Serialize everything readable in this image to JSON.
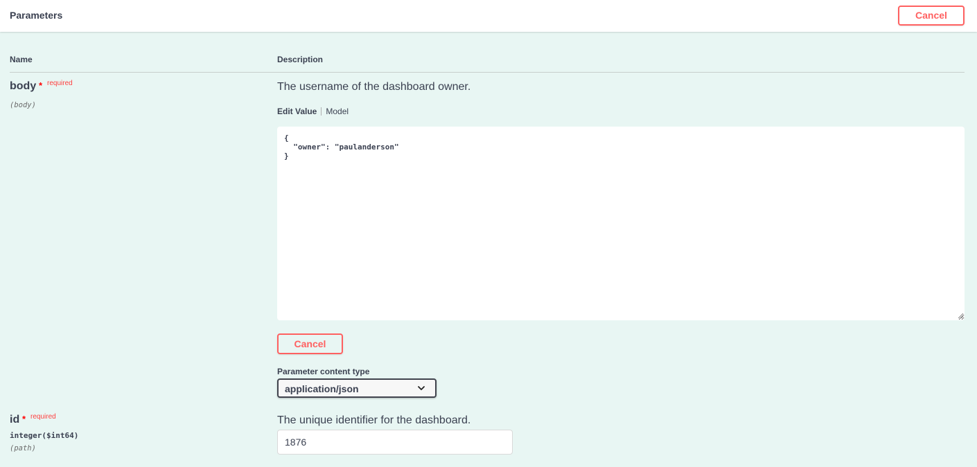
{
  "header": {
    "title": "Parameters",
    "cancel_label": "Cancel"
  },
  "columns": {
    "name": "Name",
    "description": "Description"
  },
  "params": [
    {
      "name": "body",
      "required_star": "*",
      "required_label": "required",
      "in": "(body)",
      "description": "The username of the dashboard owner.",
      "tabs": [
        "Edit Value",
        "Model"
      ],
      "value": "{\n  \"owner\": \"paulanderson\"\n}",
      "cancel_label": "Cancel",
      "content_type_label": "Parameter content type",
      "content_type_value": "application/json"
    },
    {
      "name": "id",
      "required_star": "*",
      "required_label": "required",
      "type": "integer($int64)",
      "in": "(path)",
      "description": "The unique identifier for the dashboard.",
      "value": "1876"
    }
  ],
  "colors": {
    "accent_red": "#ff6060",
    "background": "#e8f6f3"
  },
  "icons": {
    "select_chevron": "chevron-down-icon",
    "resize_handle": "resize-grip-icon"
  }
}
